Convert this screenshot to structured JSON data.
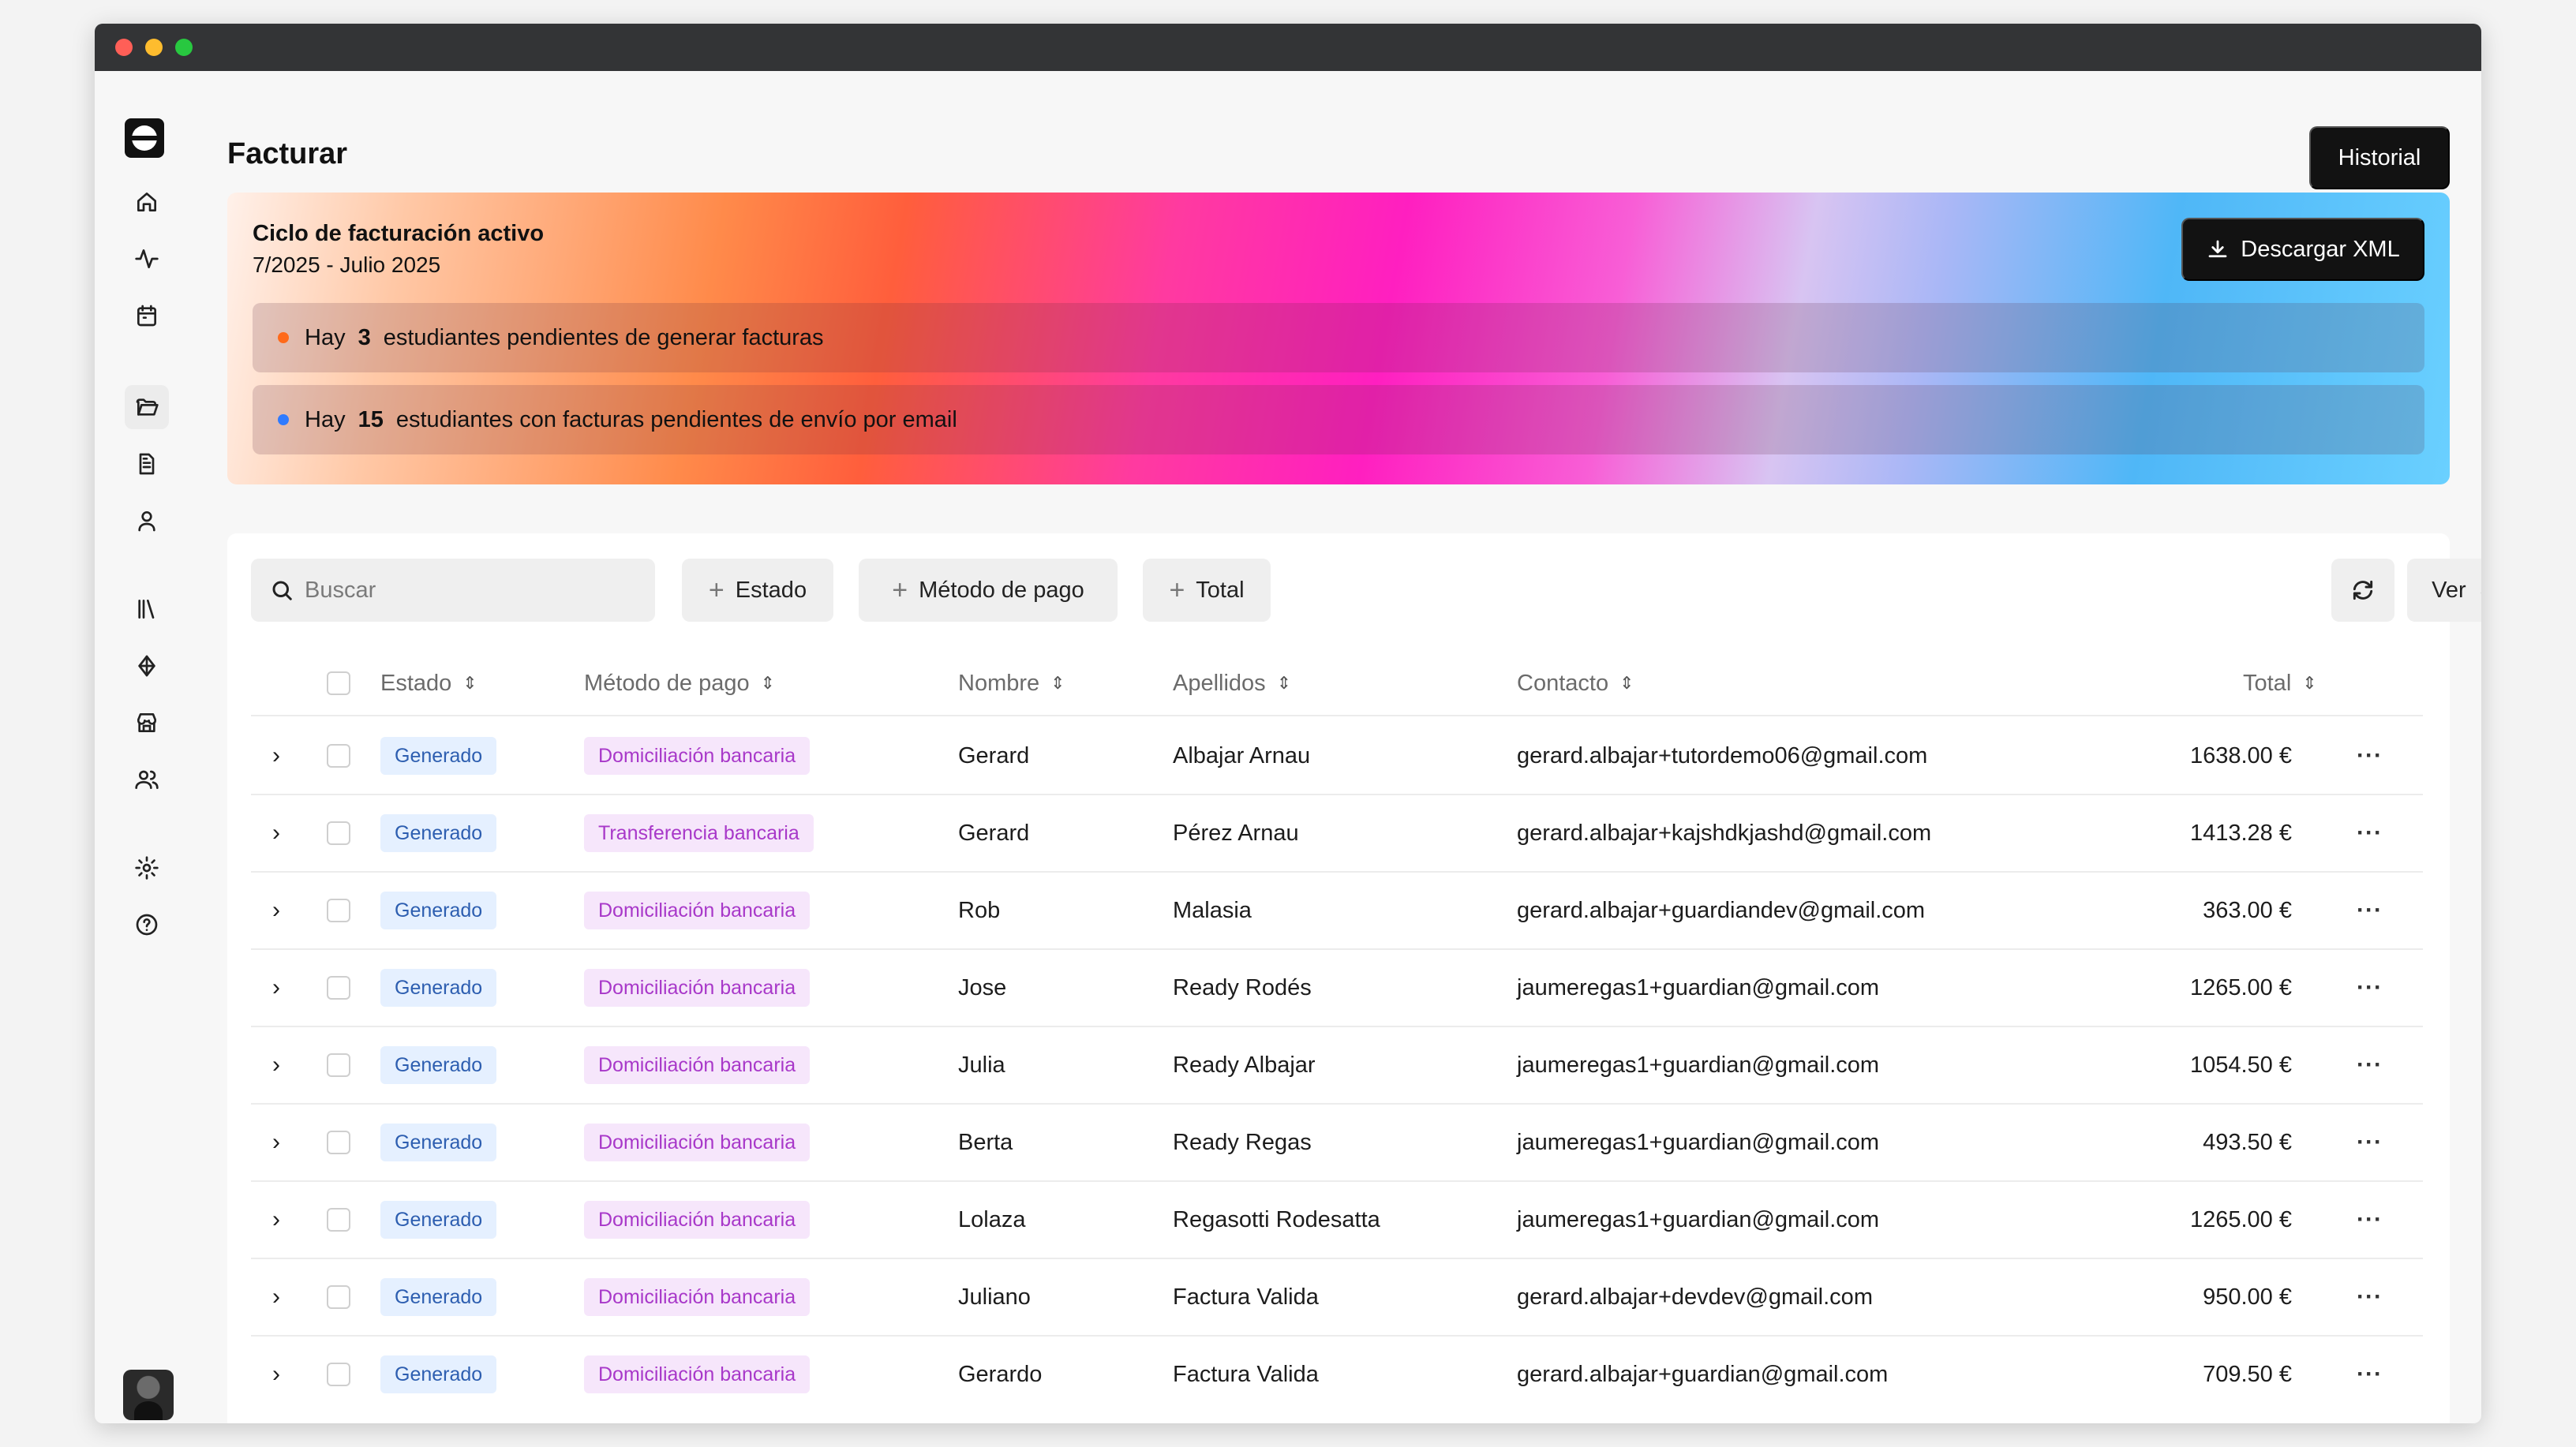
{
  "page": {
    "title": "Facturar",
    "history_label": "Historial"
  },
  "banner": {
    "title": "Ciclo de facturación activo",
    "period": "7/2025 - Julio 2025",
    "download_label": "Descargar XML",
    "notices": [
      {
        "prefix": "Hay",
        "count": "3",
        "text": "estudiantes pendientes de generar facturas",
        "color": "#ff6a1a"
      },
      {
        "prefix": "Hay",
        "count": "15",
        "text": "estudiantes con facturas pendientes de envío por email",
        "color": "#2f7bff"
      }
    ]
  },
  "toolbar": {
    "search_placeholder": "Buscar",
    "filters": [
      "Estado",
      "Método de pago",
      "Total"
    ],
    "view_label": "Ver"
  },
  "table": {
    "columns": [
      "Estado",
      "Método de pago",
      "Nombre",
      "Apellidos",
      "Contacto",
      "Total"
    ],
    "rows": [
      {
        "estado": "Generado",
        "pago": "Domiciliación bancaria",
        "nombre": "Gerard",
        "apellidos": "Albajar Arnau",
        "contacto": "gerard.albajar+tutordemo06@gmail.com",
        "total": "1638.00 €"
      },
      {
        "estado": "Generado",
        "pago": "Transferencia bancaria",
        "nombre": "Gerard",
        "apellidos": "Pérez Arnau",
        "contacto": "gerard.albajar+kajshdkjashd@gmail.com",
        "total": "1413.28 €"
      },
      {
        "estado": "Generado",
        "pago": "Domiciliación bancaria",
        "nombre": "Rob",
        "apellidos": "Malasia",
        "contacto": "gerard.albajar+guardiandev@gmail.com",
        "total": "363.00 €"
      },
      {
        "estado": "Generado",
        "pago": "Domiciliación bancaria",
        "nombre": "Jose",
        "apellidos": "Ready Rodés",
        "contacto": "jaumeregas1+guardian@gmail.com",
        "total": "1265.00 €"
      },
      {
        "estado": "Generado",
        "pago": "Domiciliación bancaria",
        "nombre": "Julia",
        "apellidos": "Ready Albajar",
        "contacto": "jaumeregas1+guardian@gmail.com",
        "total": "1054.50 €"
      },
      {
        "estado": "Generado",
        "pago": "Domiciliación bancaria",
        "nombre": "Berta",
        "apellidos": "Ready Regas",
        "contacto": "jaumeregas1+guardian@gmail.com",
        "total": "493.50 €"
      },
      {
        "estado": "Generado",
        "pago": "Domiciliación bancaria",
        "nombre": "Lolaza",
        "apellidos": "Regasotti Rodesatta",
        "contacto": "jaumeregas1+guardian@gmail.com",
        "total": "1265.00 €"
      },
      {
        "estado": "Generado",
        "pago": "Domiciliación bancaria",
        "nombre": "Juliano",
        "apellidos": "Factura Valida",
        "contacto": "gerard.albajar+devdev@gmail.com",
        "total": "950.00 €"
      },
      {
        "estado": "Generado",
        "pago": "Domiciliación bancaria",
        "nombre": "Gerardo",
        "apellidos": "Factura Valida",
        "contacto": "gerard.albajar+guardian@gmail.com",
        "total": "709.50 €"
      }
    ]
  },
  "sidebar": {
    "icons": [
      "home-icon",
      "activity-icon",
      "calendar-icon",
      "folder-open-icon",
      "document-icon",
      "user-icon",
      "library-icon",
      "droplet-icon",
      "store-icon",
      "users-icon",
      "settings-icon",
      "help-icon"
    ]
  }
}
